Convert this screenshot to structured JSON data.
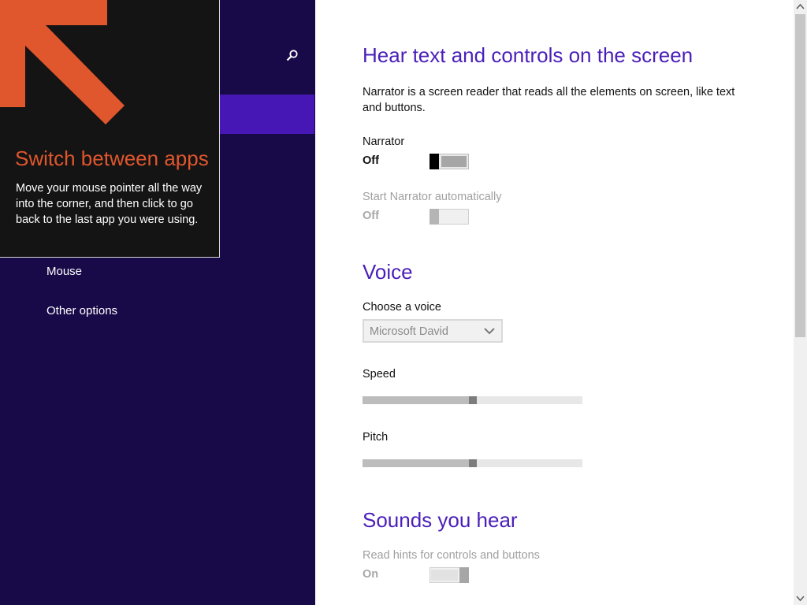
{
  "left_pane": {
    "search_icon": "search-icon",
    "nav_items": [
      {
        "label": "Mouse"
      },
      {
        "label": "Other options"
      }
    ]
  },
  "tip": {
    "title": "Switch between apps",
    "body": "Move your mouse pointer all the way into the corner, and then click to go back to the last app you were using.",
    "arrow_icon": "corner-arrow-icon",
    "accent_color": "#e0562d"
  },
  "content": {
    "heading": "Hear text and controls on the screen",
    "description": "Narrator is a screen reader that reads all the elements on screen, like text and buttons.",
    "narrator": {
      "label": "Narrator",
      "state": "Off"
    },
    "start_auto": {
      "label": "Start Narrator automatically",
      "state": "Off"
    },
    "voice": {
      "heading": "Voice",
      "choose_label": "Choose a voice",
      "selected": "Microsoft David",
      "speed_label": "Speed",
      "speed_value": 0.5,
      "pitch_label": "Pitch",
      "pitch_value": 0.5
    },
    "sounds": {
      "heading": "Sounds you hear",
      "hints_label": "Read hints for controls and buttons",
      "hints_state": "On"
    }
  },
  "colors": {
    "left_bg": "#180a48",
    "selected_bg": "#4617b4",
    "heading": "#4a1fb8"
  }
}
